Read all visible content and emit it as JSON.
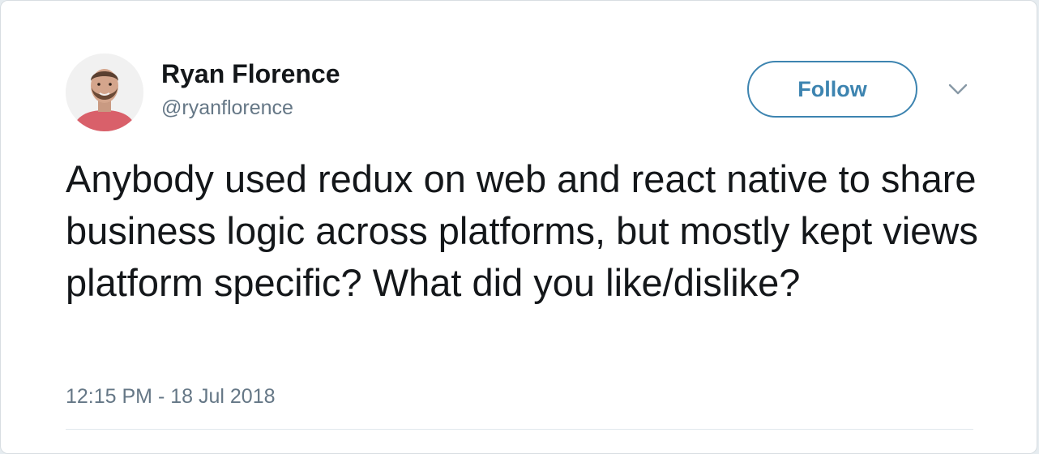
{
  "tweet": {
    "author": {
      "display_name": "Ryan Florence",
      "handle": "@ryanflorence"
    },
    "follow_label": "Follow",
    "text": "Anybody used redux on web and react native to share business logic across platforms, but mostly kept views platform specific? What did you like/dislike?",
    "timestamp": "12:15 PM - 18 Jul 2018"
  },
  "icons": {
    "more": "chevron-down-icon"
  },
  "colors": {
    "accent": "#3d84b0",
    "text_primary": "#14171a",
    "text_secondary": "#657786"
  }
}
